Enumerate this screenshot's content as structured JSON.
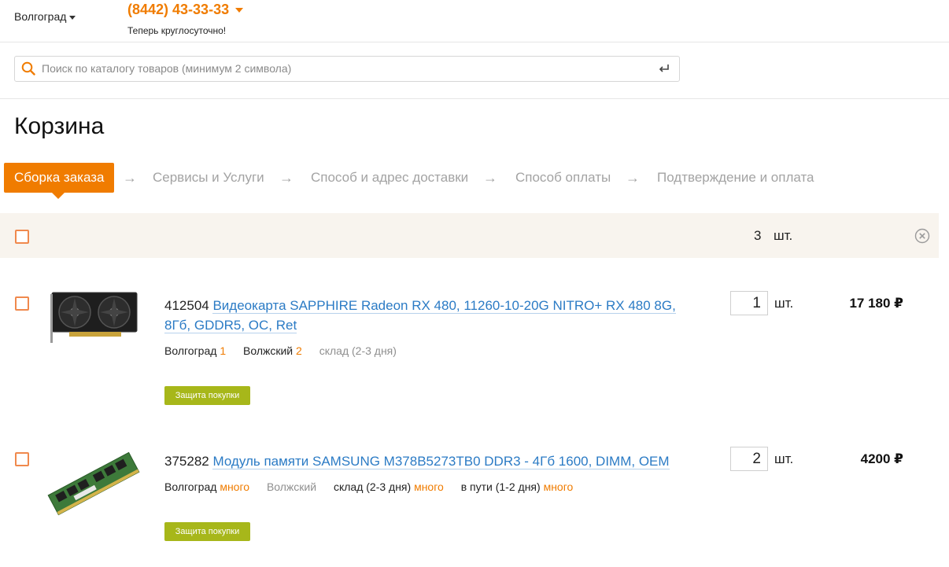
{
  "header": {
    "city": "Волгоград",
    "phone": "(8442) 43-33-33",
    "phone_note": "Теперь круглосуточно!"
  },
  "search": {
    "placeholder": "Поиск по каталогу товаров (минимум 2 символа)",
    "value": ""
  },
  "page_title": "Корзина",
  "steps": [
    "Сборка заказа",
    "Сервисы и Услуги",
    "Способ и адрес доставки",
    "Способ оплаты",
    "Подтверждение и оплата"
  ],
  "step_arrow": "→",
  "summary": {
    "count": "3",
    "unit": "шт."
  },
  "items": [
    {
      "code": "412504",
      "name": "Видеокарта SAPPHIRE Radeon RX 480, 11260-10-20G NITRO+ RX 480 8G, 8Гб, GDDR5, OC, Ret",
      "qty": "1",
      "unit": "шт.",
      "price": "17 180 ₽",
      "stock": {
        "volgograd_label": "Волгоград",
        "volgograd_value": "1",
        "volzhsky_label": "Волжский",
        "volzhsky_value": "2",
        "warehouse_label": "склад (2-3 дня)"
      },
      "protect_label": "Защита покупки"
    },
    {
      "code": "375282",
      "name": "Модуль памяти SAMSUNG M378B5273TB0 DDR3 - 4Гб 1600, DIMM, OEM",
      "qty": "2",
      "unit": "шт.",
      "price": "4200 ₽",
      "stock": {
        "volgograd_label": "Волгоград",
        "volgograd_value": "много",
        "volzhsky_label": "Волжский",
        "warehouse_label": "склад (2-3 дня)",
        "warehouse_value": "много",
        "transit_label": "в пути (1-2 дня)",
        "transit_value": "много"
      },
      "protect_label": "Защита покупки"
    }
  ],
  "colors": {
    "accent": "#f07c00",
    "link": "#2b7bc5",
    "protect": "#a7b71a",
    "summary_bg": "#f8f4ee"
  }
}
